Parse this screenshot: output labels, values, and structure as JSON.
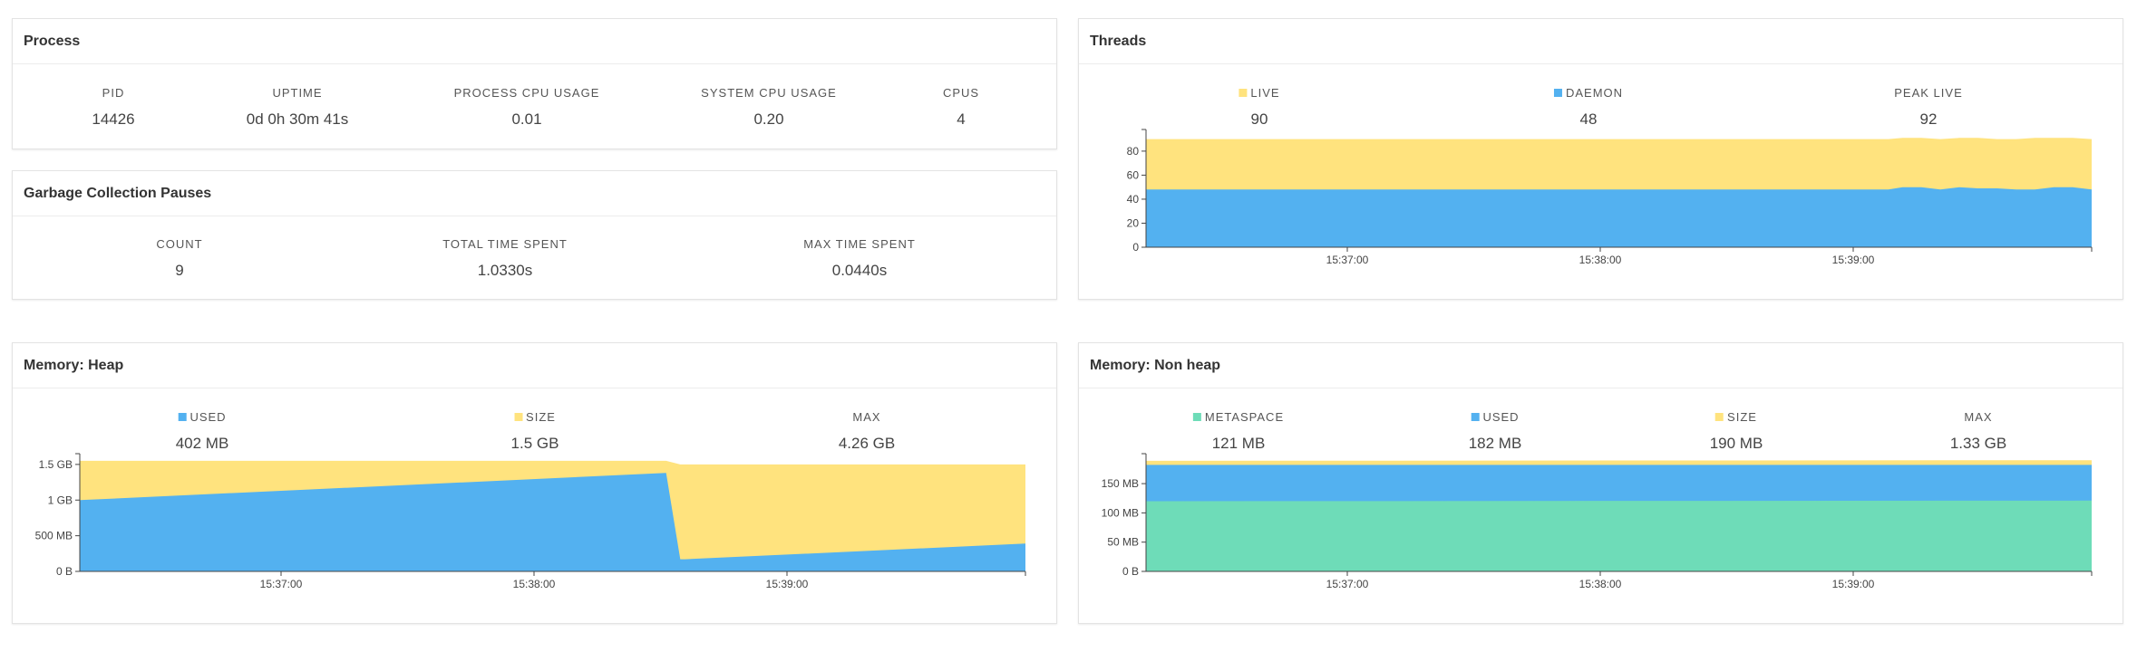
{
  "colors": {
    "yellow": "#FFE37E",
    "blue": "#53B1F0",
    "green": "#6EDCB8",
    "axis": "#444444"
  },
  "process": {
    "title": "Process",
    "stats": [
      {
        "label": "PID",
        "value": "14426"
      },
      {
        "label": "UPTIME",
        "value": "0d 0h 30m 41s"
      },
      {
        "label": "PROCESS CPU USAGE",
        "value": "0.01"
      },
      {
        "label": "SYSTEM CPU USAGE",
        "value": "0.20"
      },
      {
        "label": "CPUS",
        "value": "4"
      }
    ]
  },
  "gc": {
    "title": "Garbage Collection Pauses",
    "stats": [
      {
        "label": "COUNT",
        "value": "9"
      },
      {
        "label": "TOTAL TIME SPENT",
        "value": "1.0330s"
      },
      {
        "label": "MAX TIME SPENT",
        "value": "0.0440s"
      }
    ]
  },
  "threads": {
    "title": "Threads",
    "stats": [
      {
        "label": "LIVE",
        "value": "90",
        "color": "#FFE37E"
      },
      {
        "label": "DAEMON",
        "value": "48",
        "color": "#53B1F0"
      },
      {
        "label": "PEAK LIVE",
        "value": "92"
      }
    ]
  },
  "heap": {
    "title": "Memory: Heap",
    "stats": [
      {
        "label": "USED",
        "value": "402 MB",
        "color": "#53B1F0"
      },
      {
        "label": "SIZE",
        "value": "1.5 GB",
        "color": "#FFE37E"
      },
      {
        "label": "MAX",
        "value": "4.26 GB"
      }
    ]
  },
  "nonheap": {
    "title": "Memory: Non heap",
    "stats": [
      {
        "label": "METASPACE",
        "value": "121 MB",
        "color": "#6EDCB8"
      },
      {
        "label": "USED",
        "value": "182 MB",
        "color": "#53B1F0"
      },
      {
        "label": "SIZE",
        "value": "190 MB",
        "color": "#FFE37E"
      },
      {
        "label": "MAX",
        "value": "1.33 GB"
      }
    ]
  },
  "chart_data": [
    {
      "id": "threads",
      "type": "area",
      "x_ticks": [
        "15:37:00",
        "15:38:00",
        "15:39:00"
      ],
      "y_ticks": [
        "0",
        "20",
        "40",
        "60",
        "80"
      ],
      "ylim": [
        0,
        95
      ],
      "x": [
        0,
        0.78,
        0.785,
        0.8,
        0.82,
        0.84,
        0.86,
        0.88,
        0.9,
        0.92,
        0.94,
        0.96,
        0.98,
        1.0
      ],
      "series": [
        {
          "name": "LIVE",
          "values": [
            90,
            90,
            90,
            91,
            91,
            90,
            91,
            91,
            90,
            90,
            91,
            91,
            91,
            90
          ]
        },
        {
          "name": "DAEMON",
          "values": [
            48,
            48,
            48,
            50,
            50,
            48,
            50,
            49,
            49,
            48,
            48,
            50,
            50,
            48
          ]
        }
      ],
      "grid": false
    },
    {
      "id": "heap",
      "type": "area",
      "x_ticks": [
        "15:37:00",
        "15:38:00",
        "15:39:00"
      ],
      "y_ticks": [
        "0 B",
        "500 MB",
        "1 GB",
        "1.5 GB"
      ],
      "ylim": [
        0,
        1.6
      ],
      "x": [
        0,
        0.62,
        0.635,
        0.64,
        1.0
      ],
      "series": [
        {
          "name": "SIZE",
          "values": [
            1.55,
            1.55,
            1.5,
            1.5,
            1.5
          ]
        },
        {
          "name": "USED",
          "values": [
            1.0,
            1.38,
            0.17,
            0.17,
            0.39
          ]
        }
      ],
      "grid": false
    },
    {
      "id": "nonheap",
      "type": "area",
      "x_ticks": [
        "15:37:00",
        "15:38:00",
        "15:39:00"
      ],
      "y_ticks": [
        "0 B",
        "50 MB",
        "100 MB",
        "150 MB"
      ],
      "ylim": [
        0,
        195
      ],
      "x": [
        0,
        1.0
      ],
      "series": [
        {
          "name": "SIZE",
          "values": [
            189,
            190
          ]
        },
        {
          "name": "USED",
          "values": [
            182,
            182
          ]
        },
        {
          "name": "METASPACE",
          "values": [
            120,
            121
          ]
        }
      ],
      "grid": false
    }
  ]
}
